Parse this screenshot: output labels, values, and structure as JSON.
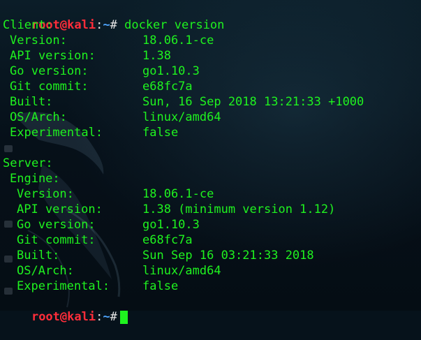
{
  "prompt": {
    "user": "root",
    "at": "@",
    "host": "kali",
    "sep": ":",
    "path": "~",
    "symbol": "#"
  },
  "command": "docker version",
  "client": {
    "header": "Client:",
    "rows": [
      {
        "key": "Version:",
        "value": "18.06.1-ce"
      },
      {
        "key": "API version:",
        "value": "1.38"
      },
      {
        "key": "Go version:",
        "value": "go1.10.3"
      },
      {
        "key": "Git commit:",
        "value": "e68fc7a"
      },
      {
        "key": "Built:",
        "value": "Sun, 16 Sep 2018 13:21:33 +1000"
      },
      {
        "key": "OS/Arch:",
        "value": "linux/amd64"
      },
      {
        "key": "Experimental:",
        "value": "false"
      }
    ]
  },
  "server": {
    "header": "Server:",
    "engine_header": "Engine:",
    "rows": [
      {
        "key": "Version:",
        "value": "18.06.1-ce"
      },
      {
        "key": "API version:",
        "value": "1.38 (minimum version 1.12)"
      },
      {
        "key": "Go version:",
        "value": "go1.10.3"
      },
      {
        "key": "Git commit:",
        "value": "e68fc7a"
      },
      {
        "key": "Built:",
        "value": "Sun Sep 16 03:21:33 2018"
      },
      {
        "key": "OS/Arch:",
        "value": "linux/amd64"
      },
      {
        "key": "Experimental:",
        "value": "false"
      }
    ]
  },
  "colors": {
    "output": "#1ff31f",
    "prompt_user": "#ff2d3a",
    "prompt_path": "#4fa6ff"
  }
}
